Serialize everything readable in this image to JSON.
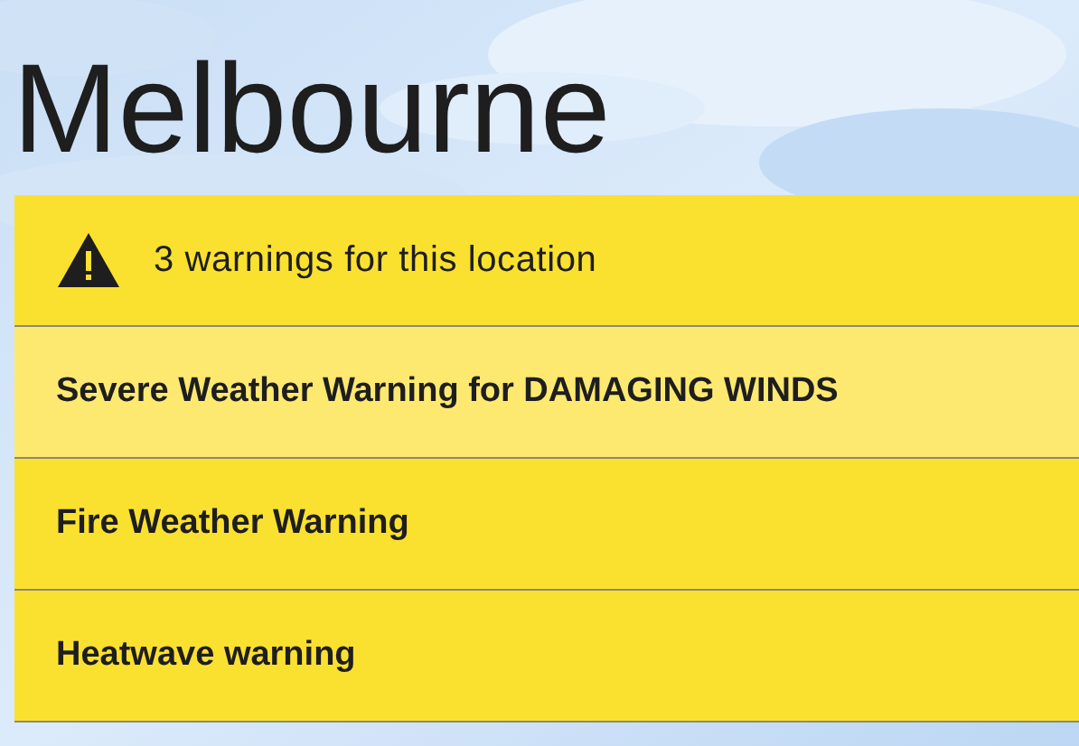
{
  "title": "Melbourne",
  "warnings_summary": "3 warnings for this location",
  "warnings": [
    {
      "label": "Severe Weather Warning for DAMAGING WINDS",
      "selected": true
    },
    {
      "label": "Fire Weather Warning",
      "selected": false
    },
    {
      "label": "Heatwave warning",
      "selected": false
    }
  ]
}
